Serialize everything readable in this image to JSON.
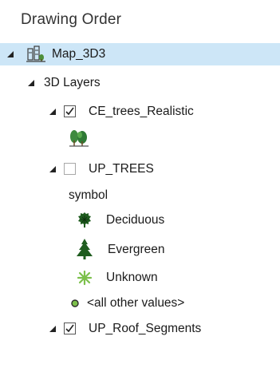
{
  "panel": {
    "title": "Drawing Order"
  },
  "tree": {
    "map": {
      "label": "Map_3D3",
      "icon": "map-3d-icon"
    },
    "group": {
      "label": "3D Layers"
    },
    "layer1": {
      "label": "CE_trees_Realistic",
      "checked": true,
      "icon": "realistic-trees-icon"
    },
    "layer2": {
      "label": "UP_TREES",
      "checked": false,
      "symbol_heading": "symbol",
      "classes": [
        {
          "label": "Deciduous",
          "icon": "deciduous-tree-icon"
        },
        {
          "label": "Evergreen",
          "icon": "evergreen-tree-icon"
        },
        {
          "label": "Unknown",
          "icon": "unknown-star-icon"
        },
        {
          "label": "<all other values>",
          "icon": "dot-icon"
        }
      ]
    },
    "layer3": {
      "label": "UP_Roof_Segments",
      "checked": true
    }
  },
  "colors": {
    "selection": "#cde6f7",
    "tree_green": "#1f5c1f",
    "unknown_green": "#7cc04b"
  }
}
